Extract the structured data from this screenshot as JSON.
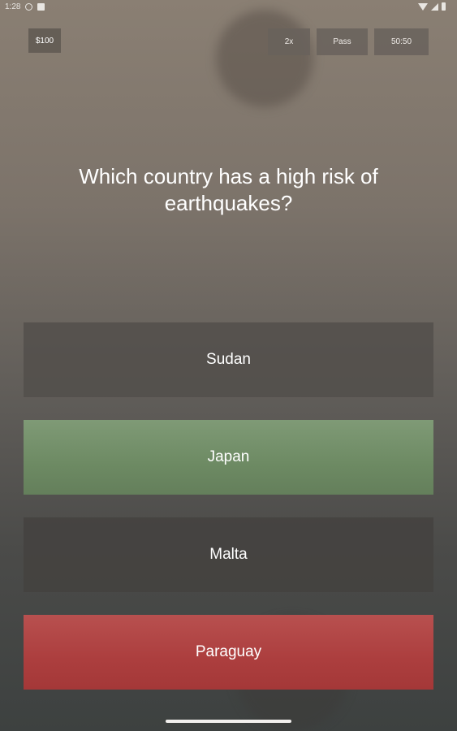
{
  "status_bar": {
    "time": "1:28",
    "left_icons": [
      "sync-icon",
      "notification-square-icon"
    ],
    "right_icons": [
      "wifi-icon",
      "signal-icon",
      "battery-icon"
    ]
  },
  "score": {
    "amount": "$100"
  },
  "lifelines": {
    "double": "2x",
    "pass": "Pass",
    "fifty_fifty": "50:50"
  },
  "question": {
    "text": "Which country has a high risk of earthquakes?"
  },
  "answers": [
    {
      "label": "Sudan",
      "state": "neutral"
    },
    {
      "label": "Japan",
      "state": "correct"
    },
    {
      "label": "Malta",
      "state": "neutral"
    },
    {
      "label": "Paraguay",
      "state": "wrong"
    }
  ],
  "colors": {
    "correct": "#6d8a63",
    "wrong": "#ac3e3e",
    "neutral": "#524e4a"
  }
}
